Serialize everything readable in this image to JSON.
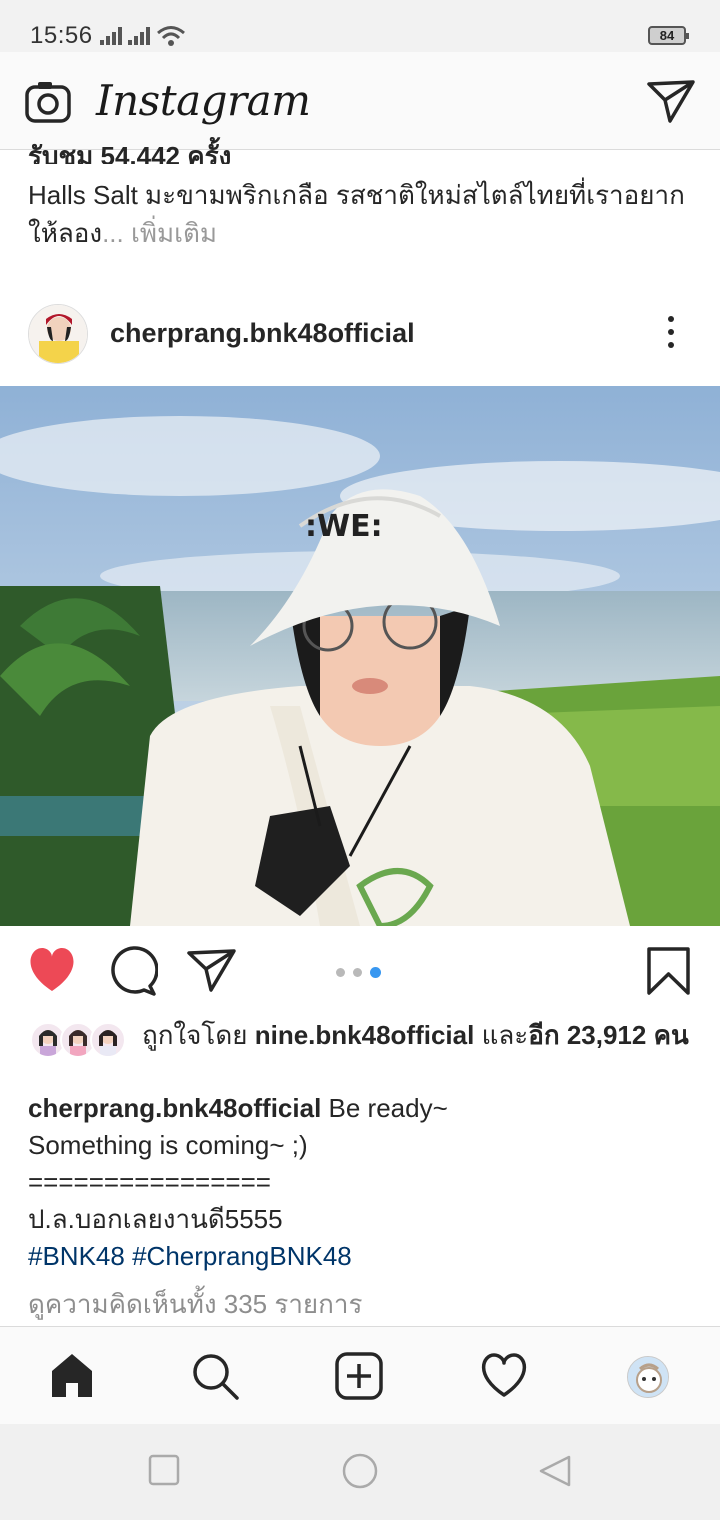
{
  "status_bar": {
    "time": "15:56",
    "battery": "84"
  },
  "header": {
    "app_name": "Instagram",
    "camera_icon": "camera-icon",
    "direct_icon": "paper-plane-icon"
  },
  "previous_post": {
    "cut_text": "รับชม 54,442 ครั้ง",
    "caption": "Halls Salt มะขามพริกเกลือ รสชาติใหม่สไตล์ไทยที่เราอยากให้ลอง",
    "ellipsis": "...",
    "more_label": " เพิ่มเติม"
  },
  "post": {
    "username": "cherprang.bnk48official",
    "options_icon": "more-vertical-icon",
    "photo_alt": "Selfie with white bucket hat and glasses at seaside",
    "carousel": {
      "count": 3,
      "active": 3
    },
    "liked_by_prefix": "ถูกใจโดย ",
    "liked_by_user": "nine.bnk48official",
    "liked_by_mid": " และ",
    "liked_by_others": "อีก 23,912 คน",
    "caption_user": "cherprang.bnk48official",
    "caption_line1": " Be ready~",
    "caption_line2": "Something is coming~ ;)",
    "caption_line3": "================",
    "caption_line4": "ป.ล.บอกเลยงานดี5555",
    "hashtag1": "#BNK48",
    "hashtag2": "#CherprangBNK48",
    "view_comments": "ดูความคิดเห็นทั้ง 335 รายการ"
  },
  "colors": {
    "like_red": "#ed4956",
    "link_blue": "#003569",
    "carousel_active": "#3897f0"
  },
  "bottom_nav": {
    "items": [
      "home-icon",
      "search-icon",
      "add-post-icon",
      "activity-heart-icon",
      "profile-avatar"
    ]
  },
  "system_nav": {
    "items": [
      "recent-apps-icon",
      "home-circle-icon",
      "back-icon"
    ]
  }
}
